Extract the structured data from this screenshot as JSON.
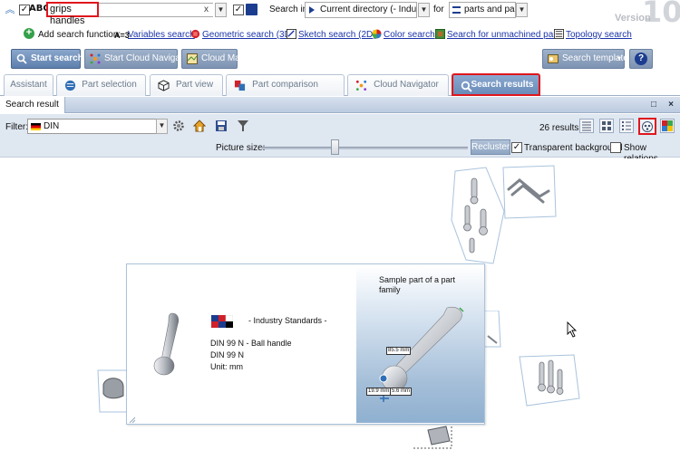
{
  "search": {
    "abc_label": "ABC",
    "query": "grips handles",
    "clear_glyph": "x",
    "dropdown_glyph": "▼",
    "search_in_label": "Search in",
    "search_in_value": "Current directory (- Industr",
    "for_label": "for",
    "for_value": "parts and part",
    "version_label": "Version",
    "version_number": "10"
  },
  "add_search": {
    "label": "Add search function:",
    "variables_prefix": "A=3",
    "items": [
      {
        "label": "Variables search"
      },
      {
        "label": "Geometric search (3D)"
      },
      {
        "label": "Sketch search (2D)"
      },
      {
        "label": "Color search"
      },
      {
        "label": "Search for unmachined parts"
      },
      {
        "label": "Topology search"
      }
    ]
  },
  "toolbar": {
    "start_search": "Start search",
    "start_cloud_navigator": "Start Cloud Navigator",
    "cloud_map": "Cloud Map",
    "search_templates": "Search templates",
    "help_glyph": "?"
  },
  "tabs": [
    {
      "label": "Assistant"
    },
    {
      "label": "Part selection"
    },
    {
      "label": "Part view"
    },
    {
      "label": "Part comparison"
    },
    {
      "label": "Cloud Navigator"
    },
    {
      "label": "Search results"
    }
  ],
  "panel": {
    "title": "Search result",
    "maximize_glyph": "□",
    "close_glyph": "×"
  },
  "filter": {
    "label": "Filter:",
    "value": "DIN",
    "results_count": "26 results"
  },
  "picture": {
    "size_label": "Picture size:",
    "recluster": "Recluster",
    "transparent_bg_label": "Transparent background",
    "transparent_bg_checked": true,
    "show_relations_label": "Show relations",
    "show_relations_checked": false
  },
  "popup": {
    "catalog": "- Industry Standards -",
    "part_name": "DIN 99 N - Ball handle",
    "part_number": "DIN 99 N",
    "unit": "Unit: mm",
    "preview_caption": "Sample part of a part family",
    "dims": [
      "85.5 mm",
      "19.9 mm",
      "5.6 mm"
    ]
  },
  "colors": {
    "highlight_red": "#e0161d",
    "link_blue": "#1a33a8",
    "active_tab": "#6a8cba"
  }
}
